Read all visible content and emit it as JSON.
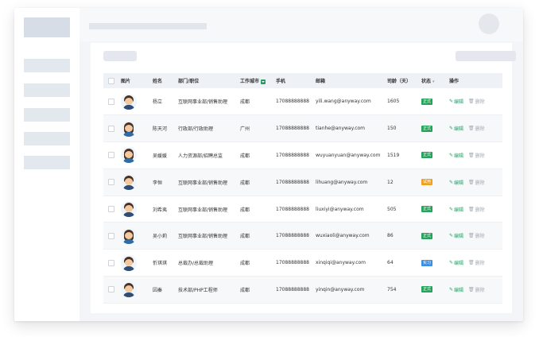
{
  "table": {
    "headers": {
      "photo": "图片",
      "name": "姓名",
      "dept": "部门/职位",
      "city": "工作城市",
      "phone": "手机",
      "email": "邮箱",
      "tenure": "司龄（天）",
      "status": "状态",
      "actions": "操作"
    },
    "edit_label": "编辑",
    "delete_label": "删除",
    "rows": [
      {
        "avatar": "male-avatar",
        "name": "杨立",
        "dept": "互联网事业部/销售助理",
        "city": "成都",
        "phone": "17088888888",
        "email": "yili.wang@anyway.com",
        "tenure": "1605",
        "status": "正式",
        "status_color": "#24a35a"
      },
      {
        "avatar": "female-avatar",
        "name": "陈天河",
        "dept": "行政部/行政助理",
        "city": "广州",
        "phone": "17088888888",
        "email": "tianhe@anyway.com",
        "tenure": "150",
        "status": "正式",
        "status_color": "#24a35a"
      },
      {
        "avatar": "female-avatar",
        "name": "吴媛媛",
        "dept": "人力资源部/招聘总监",
        "city": "成都",
        "phone": "17088888888",
        "email": "wuyuanyuan@anyway.com",
        "tenure": "1519",
        "status": "正式",
        "status_color": "#24a35a"
      },
      {
        "avatar": "male-avatar",
        "name": "李恒",
        "dept": "互联网事业部/销售助理",
        "city": "成都",
        "phone": "17088888888",
        "email": "lihuang@anyway.com",
        "tenure": "12",
        "status": "试用",
        "status_color": "#f0a020"
      },
      {
        "avatar": "male-avatar",
        "name": "刘希夷",
        "dept": "互联网事业部/销售助理",
        "city": "成都",
        "phone": "17088888888",
        "email": "liuxiyi@anyway.com",
        "tenure": "505",
        "status": "正式",
        "status_color": "#24a35a"
      },
      {
        "avatar": "female-avatar",
        "name": "吴小莉",
        "dept": "互联网事业部/销售助理",
        "city": "成都",
        "phone": "17088888888",
        "email": "wuxiaoli@anyway.com",
        "tenure": "86",
        "status": "正式",
        "status_color": "#24a35a"
      },
      {
        "avatar": "male-avatar",
        "name": "忻琪琪",
        "dept": "总裁办/总裁助理",
        "city": "成都",
        "phone": "17088888888",
        "email": "xinqiqi@anyway.com",
        "tenure": "64",
        "status": "实习",
        "status_color": "#3a8ee6"
      },
      {
        "avatar": "male-avatar",
        "name": "因秦",
        "dept": "技术部/PHP工程师",
        "city": "成都",
        "phone": "17088888888",
        "email": "yinqin@anyway.com",
        "tenure": "754",
        "status": "正式",
        "status_color": "#24a35a"
      }
    ]
  }
}
